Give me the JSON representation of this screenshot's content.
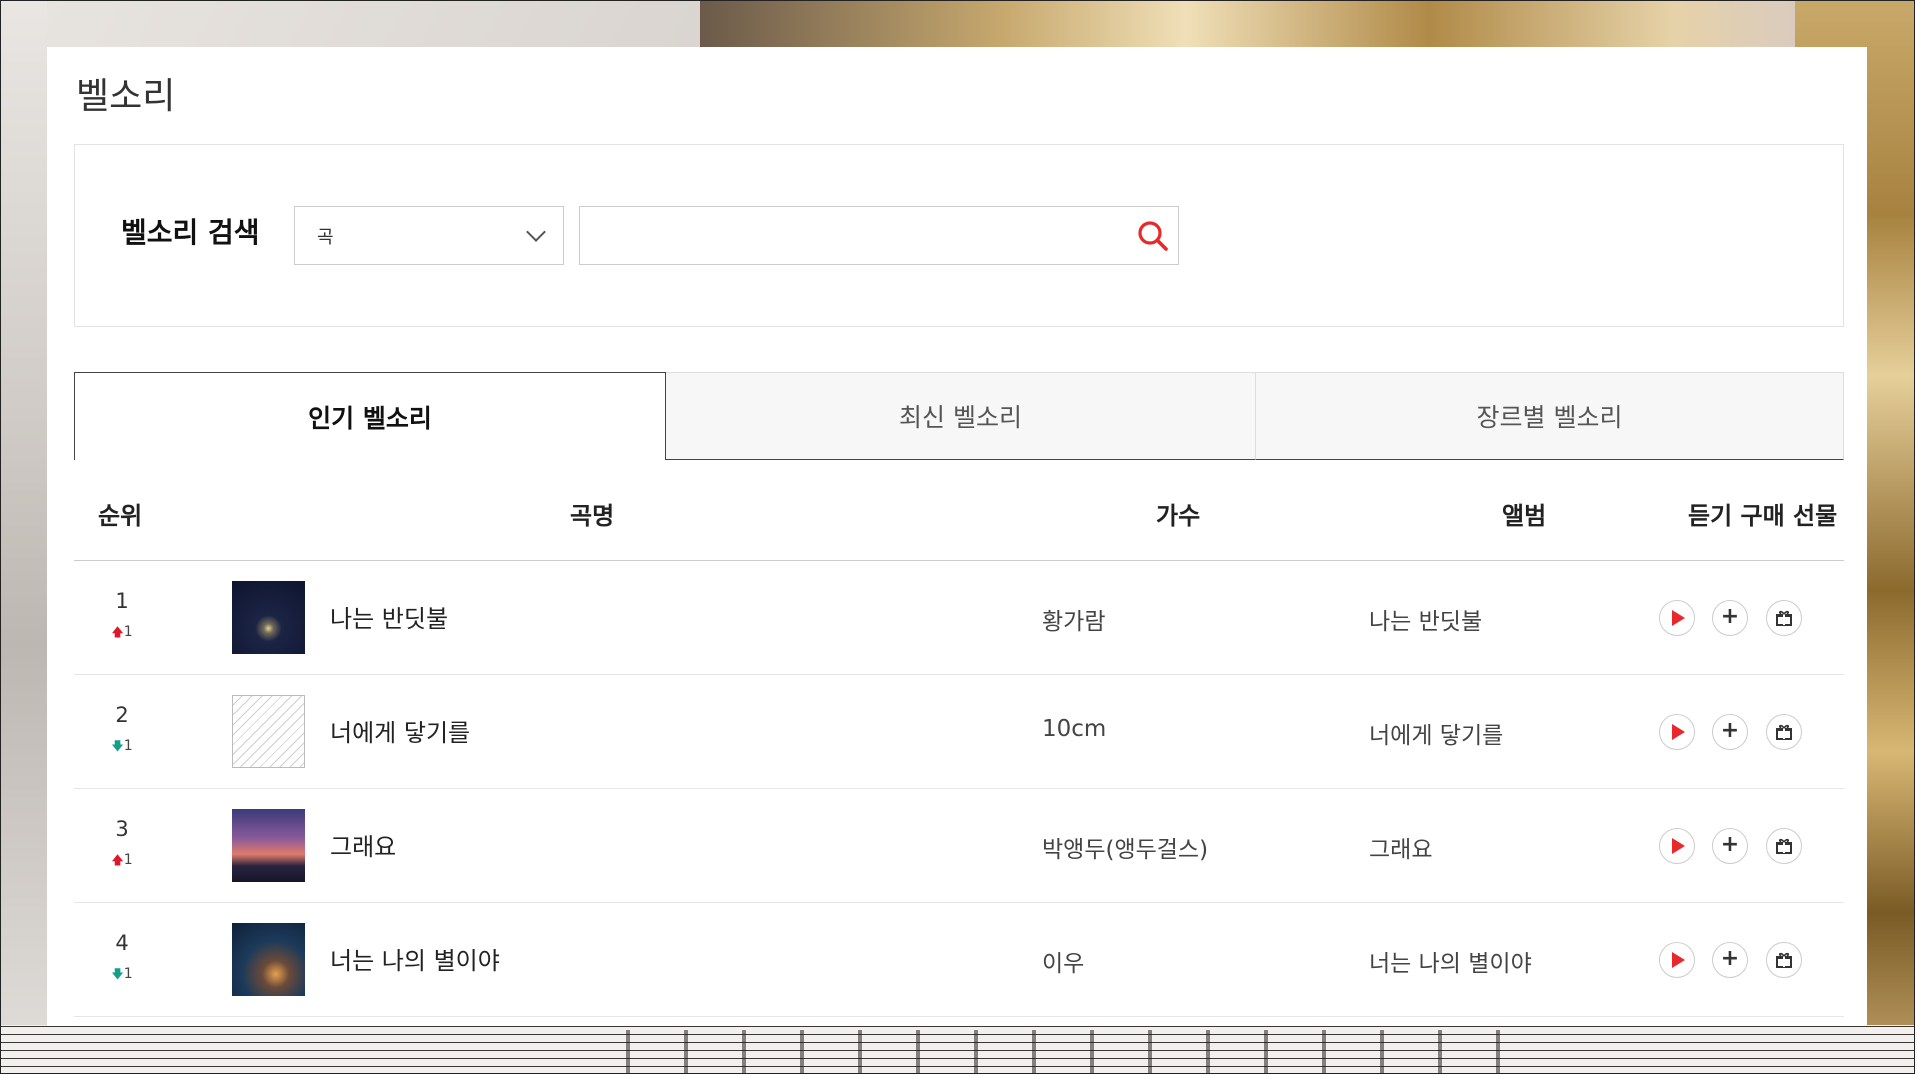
{
  "page_title": "벨소리",
  "search": {
    "label": "벨소리 검색",
    "select_value": "곡",
    "input_value": "",
    "input_placeholder": ""
  },
  "tabs": [
    {
      "label": "인기 벨소리",
      "active": true
    },
    {
      "label": "최신 벨소리",
      "active": false
    },
    {
      "label": "장르별 벨소리",
      "active": false
    }
  ],
  "table": {
    "headers": {
      "rank": "순위",
      "title": "곡명",
      "artist": "가수",
      "album": "앨범",
      "actions": "듣기 구매 선물"
    },
    "rows": [
      {
        "rank": "1",
        "change": "1",
        "direction": "up",
        "title": "나는 반딧불",
        "artist": "황가람",
        "album": "나는 반딧불"
      },
      {
        "rank": "2",
        "change": "1",
        "direction": "down",
        "title": "너에게 닿기를",
        "artist": "10cm",
        "album": "너에게 닿기를"
      },
      {
        "rank": "3",
        "change": "1",
        "direction": "up",
        "title": "그래요",
        "artist": "박앵두(앵두걸스)",
        "album": "그래요"
      },
      {
        "rank": "4",
        "change": "1",
        "direction": "down",
        "title": "너는 나의 별이야",
        "artist": "이우",
        "album": "너는 나의 별이야"
      }
    ]
  },
  "colors": {
    "accent_red": "#e8282b",
    "rank_up": "#e0162b",
    "rank_down": "#12a08a"
  },
  "icons": {
    "search": "search-icon",
    "select": "chevron-down-icon",
    "play": "play-icon",
    "add": "plus-icon",
    "gift": "gift-icon",
    "up": "arrow-up-icon",
    "down": "arrow-down-icon"
  }
}
